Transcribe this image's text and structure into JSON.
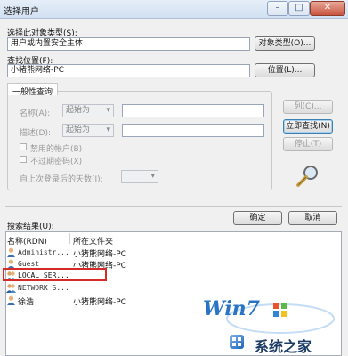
{
  "window": {
    "title": "选择用户",
    "controls": {
      "minimize": "–",
      "maximize": "□",
      "close": "✕"
    }
  },
  "object_type": {
    "label": "选择此对象类型(S):",
    "value": "用户或内置安全主体",
    "button": "对象类型(O)..."
  },
  "location": {
    "label": "查找位置(F):",
    "value": "小猪熊网络-PC",
    "button": "位置(L)..."
  },
  "tab": {
    "label": "一般性查询"
  },
  "query": {
    "name_label": "名称(A):",
    "name_op": "起始为",
    "desc_label": "描述(D):",
    "desc_op": "起始为",
    "disabled_accounts": "禁用的帐户(B)",
    "no_expire_password": "不过期密码(X)",
    "days_label": "自上次登录后的天数(I):"
  },
  "side_buttons": {
    "columns": "列(C)...",
    "find_now": "立即查找(N)",
    "stop": "停止(T)"
  },
  "results": {
    "label": "搜索结果(U):",
    "ok": "确定",
    "cancel": "取消",
    "headers": [
      "名称(RDN)",
      "所在文件夹"
    ],
    "rows": [
      {
        "name": "Administr...",
        "folder": "小猪熊网络-PC"
      },
      {
        "name": "Guest",
        "folder": "小猪熊网络-PC"
      },
      {
        "name": "LOCAL SER...",
        "folder": ""
      },
      {
        "name": "NETWORK S...",
        "folder": ""
      },
      {
        "name": "徐浩",
        "folder": "小猪熊网络-PC"
      }
    ]
  },
  "watermark": {
    "logo": "Win7",
    "site": "系统之家"
  },
  "colors": {
    "highlight_box": "#d42a2a",
    "accent_blue": "#3c7fb1"
  }
}
